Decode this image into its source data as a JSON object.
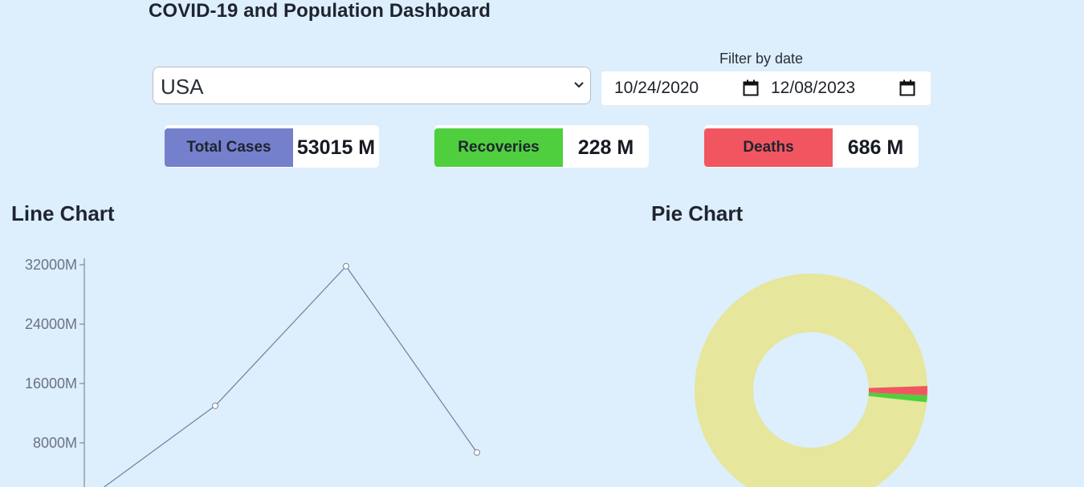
{
  "header": {
    "title": "COVID-19 and Population Dashboard"
  },
  "filters": {
    "country": {
      "value": "USA"
    },
    "date_label": "Filter by date",
    "start_date": "10/24/2020",
    "end_date": "12/08/2023"
  },
  "stats": {
    "total_cases": {
      "label": "Total Cases",
      "value": "53015 M",
      "color": "#7580cc"
    },
    "recoveries": {
      "label": "Recoveries",
      "value": "228 M",
      "color": "#4fcf3e"
    },
    "deaths": {
      "label": "Deaths",
      "value": "686 M",
      "color": "#f15660"
    }
  },
  "line_section": {
    "title": "Line Chart"
  },
  "pie_section": {
    "title": "Pie Chart"
  },
  "chart_data": [
    {
      "type": "line",
      "y_tick_labels": [
        "32000M",
        "24000M",
        "16000M",
        "8000M"
      ],
      "y_ticks": [
        32000,
        24000,
        16000,
        8000
      ],
      "ylim": [
        0,
        32000
      ],
      "series": [
        {
          "values": [
            100,
            13000,
            31800,
            6700
          ],
          "color": "#6b80a8"
        }
      ],
      "grid": false
    },
    {
      "type": "pie",
      "variant": "donut",
      "values": [
        53015,
        228,
        686
      ],
      "colors": [
        "#e6e69c",
        "#4fcf3e",
        "#f15660"
      ]
    }
  ]
}
